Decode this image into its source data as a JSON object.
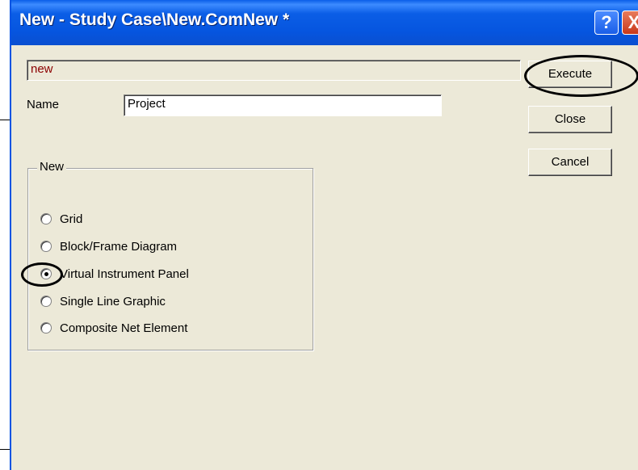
{
  "window": {
    "title": "New - Study Case\\New.ComNew *",
    "help_glyph": "?",
    "close_glyph": "X"
  },
  "form": {
    "class_value": "new",
    "name_label": "Name",
    "name_value": "Project"
  },
  "buttons": {
    "execute": "Execute",
    "close": "Close",
    "cancel": "Cancel"
  },
  "group": {
    "legend": "New",
    "options": [
      {
        "label": "Grid",
        "selected": false
      },
      {
        "label": "Block/Frame Diagram",
        "selected": false
      },
      {
        "label": "Virtual Instrument Panel",
        "selected": true
      },
      {
        "label": "Single Line Graphic",
        "selected": false
      },
      {
        "label": "Composite Net Element",
        "selected": false
      }
    ]
  },
  "colors": {
    "title_bar": "#0a5ee8",
    "dialog_bg": "#ece9d8",
    "class_text": "#8b0000",
    "annotation": "#000000"
  }
}
